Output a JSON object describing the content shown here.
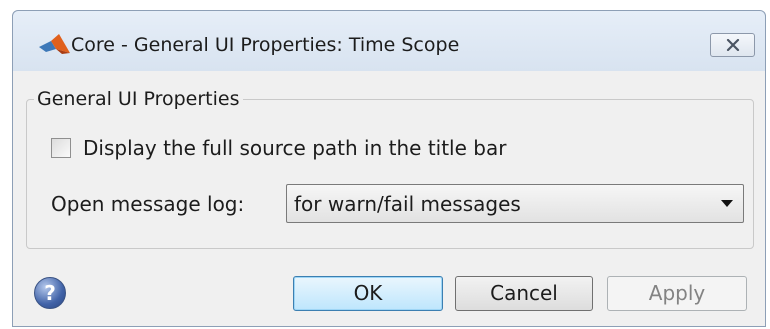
{
  "window": {
    "title": "Core - General UI Properties: Time Scope",
    "app_icon": "matlab-logo-icon",
    "close_icon": "close-icon"
  },
  "group": {
    "title": "General UI Properties",
    "full_path_checkbox": {
      "label": "Display the full source path in the title bar",
      "checked": false
    },
    "message_log": {
      "label": "Open message log:",
      "selected": "for warn/fail messages"
    }
  },
  "footer": {
    "help_icon": "help-icon",
    "help_glyph": "?",
    "ok_label": "OK",
    "cancel_label": "Cancel",
    "apply_label": "Apply",
    "apply_enabled": false
  },
  "colors": {
    "frame": "#d8e3f0",
    "client": "#f0f0f0",
    "default_button": "#bee6fd"
  }
}
